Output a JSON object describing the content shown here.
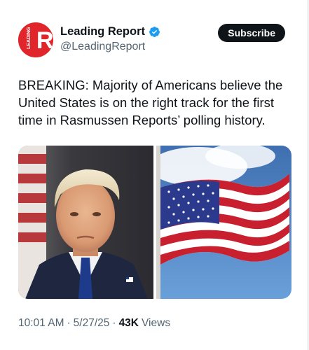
{
  "account": {
    "display_name": "Leading Report",
    "handle": "@LeadingReport",
    "avatar_text": "LEADING",
    "avatar_letter": "R",
    "verified": true,
    "brand_color": "#e0262b",
    "verified_color": "#1d9bf0"
  },
  "actions": {
    "subscribe_label": "Subscribe"
  },
  "tweet": {
    "text": "BREAKING: Majority of Americans believe the United States is on the right track for the first time in Rasmussen Reports’ polling history.",
    "time": "10:01 AM",
    "date": "5/27/25",
    "separator": "·",
    "views_count": "43K",
    "views_label": "Views"
  },
  "media": {
    "images": [
      {
        "icon": "portrait-photo"
      },
      {
        "icon": "american-flag-photo"
      }
    ]
  }
}
